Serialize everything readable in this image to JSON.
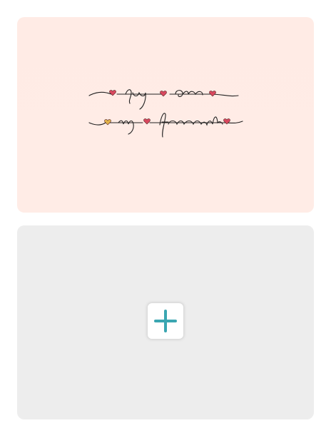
{
  "cards": [
    {
      "type": "image",
      "background_color": "#ffebe5",
      "script_lines": [
        "you are",
        "my favourite"
      ]
    },
    {
      "type": "add",
      "background_color": "#ededed",
      "add_button": {
        "icon": "plus-icon",
        "accent_color": "#3aa6b1"
      }
    }
  ]
}
